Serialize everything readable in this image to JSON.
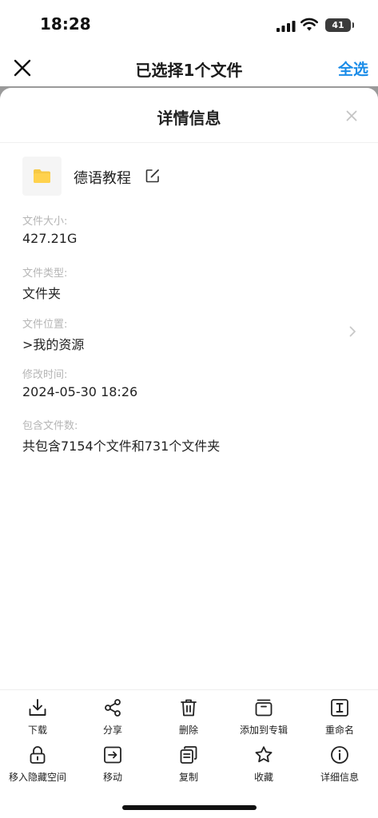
{
  "status_bar": {
    "time": "18:28",
    "battery": "41"
  },
  "top_bar": {
    "title": "已选择1个文件",
    "select_all": "全选",
    "close_icon": "close-icon"
  },
  "sheet": {
    "title": "详情信息",
    "file": {
      "name": "德语教程",
      "icon": "folder-icon",
      "icon_color": "#f6c945"
    },
    "fields": [
      {
        "label": "文件大小:",
        "value": "427.21G"
      },
      {
        "label": "文件类型:",
        "value": "文件夹"
      },
      {
        "label": "文件位置:",
        "value": ">我的资源"
      },
      {
        "label": "修改时间:",
        "value": "2024-05-30 18:26"
      },
      {
        "label": "包含文件数:",
        "value": "共包含7154个文件和731个文件夹"
      }
    ]
  },
  "toolbar": {
    "row1": [
      {
        "label": "下载",
        "icon": "download-icon"
      },
      {
        "label": "分享",
        "icon": "share-icon"
      },
      {
        "label": "删除",
        "icon": "trash-icon"
      },
      {
        "label": "添加到专辑",
        "icon": "album-icon"
      },
      {
        "label": "重命名",
        "icon": "rename-icon"
      }
    ],
    "row2": [
      {
        "label": "移入隐藏空间",
        "icon": "lock-icon"
      },
      {
        "label": "移动",
        "icon": "move-icon"
      },
      {
        "label": "复制",
        "icon": "copy-icon"
      },
      {
        "label": "收藏",
        "icon": "star-icon"
      },
      {
        "label": "详细信息",
        "icon": "info-icon"
      }
    ]
  },
  "colors": {
    "accent": "#1a8ce8",
    "label_gray": "#b5b5b5",
    "folder_yellow": "#f6c945"
  }
}
